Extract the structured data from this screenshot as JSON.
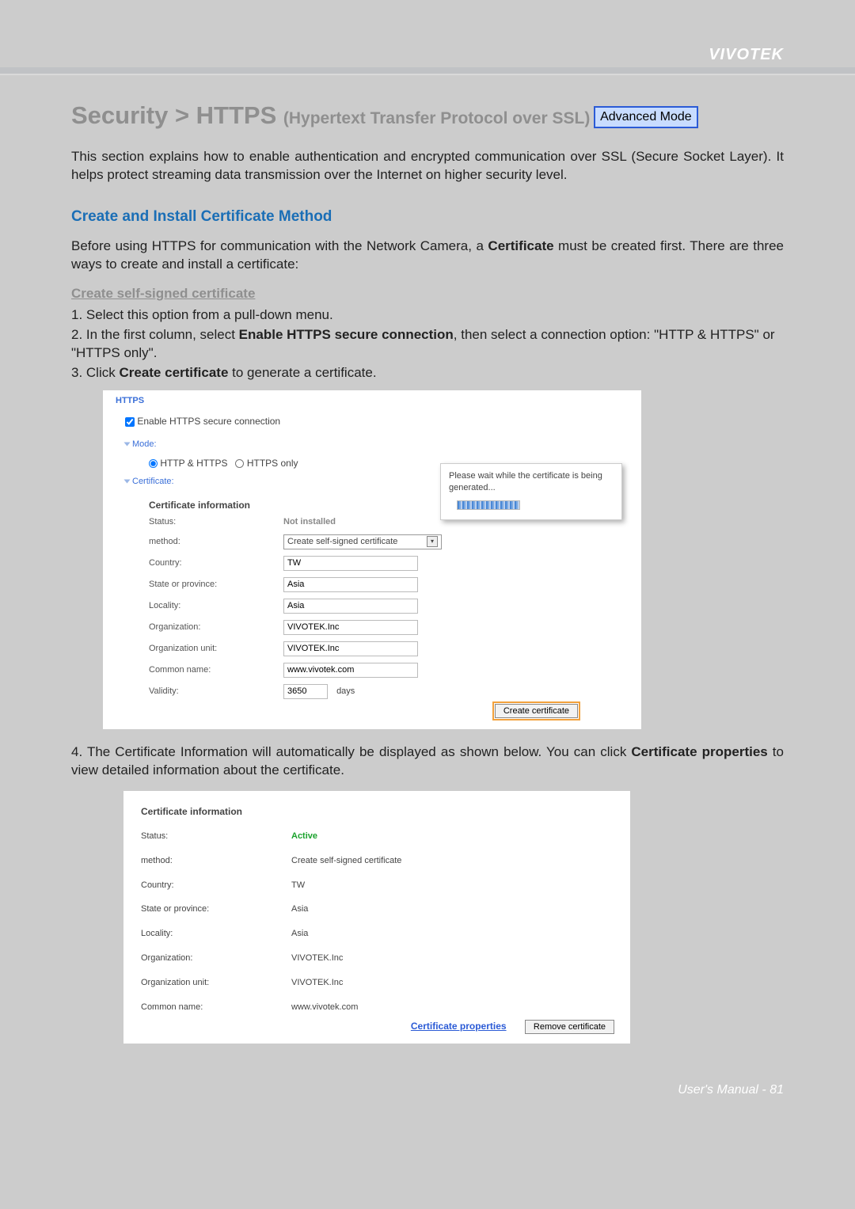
{
  "brand": "VIVOTEK",
  "title": {
    "main": "Security >  HTTPS ",
    "sub": "(Hypertext Transfer Protocol over SSL)",
    "badge": "Advanced Mode"
  },
  "intro": "This section explains how to enable authentication and encrypted communication over SSL (Secure Socket Layer). It helps protect streaming data transmission over the Internet on higher security level.",
  "section_head": "Create and Install Certificate Method",
  "para_before": "Before using HTTPS for communication with the Network Camera, a ",
  "para_before_bold": "Certificate",
  "para_before_rest": " must be created first. There are three ways to create and install a certificate:",
  "sub_head": "Create self-signed certificate",
  "steps": {
    "s1": "1. Select this option from a pull-down menu.",
    "s2a": "2. In the first column, select ",
    "s2b": "Enable HTTPS secure connection",
    "s2c": ", then select a connection option: \"HTTP & HTTPS\" or \"HTTPS only\".",
    "s3a": "3. Click ",
    "s3b": "Create certificate",
    "s3c": " to generate a certificate."
  },
  "shot1": {
    "fieldset": "HTTPS",
    "enable_label": "Enable HTTPS secure connection",
    "mode_label": "Mode:",
    "radio1": "HTTP & HTTPS",
    "radio2": "HTTPS only",
    "cert_label": "Certificate:",
    "cert_info_head": "Certificate information",
    "rows": {
      "status_l": "Status:",
      "status_v": "Not installed",
      "method_l": "method:",
      "method_v": "Create self-signed certificate",
      "country_l": "Country:",
      "country_v": "TW",
      "state_l": "State or province:",
      "state_v": "Asia",
      "locality_l": "Locality:",
      "locality_v": "Asia",
      "org_l": "Organization:",
      "org_v": "VIVOTEK.Inc",
      "orgunit_l": "Organization unit:",
      "orgunit_v": "VIVOTEK.Inc",
      "common_l": "Common name:",
      "common_v": "www.vivotek.com",
      "validity_l": "Validity:",
      "validity_v": "3650",
      "validity_unit": "days"
    },
    "create_btn": "Create certificate",
    "popup_text": "Please wait while the certificate is being generated..."
  },
  "step4a": "4. The Certificate Information will automatically be displayed as shown below. You can click ",
  "step4b": "Certificate properties",
  "step4c": " to view detailed information about the certificate.",
  "shot2": {
    "cert_info_head": "Certificate information",
    "rows": {
      "status_l": "Status:",
      "status_v": "Active",
      "method_l": "method:",
      "method_v": "Create self-signed certificate",
      "country_l": "Country:",
      "country_v": "TW",
      "state_l": "State or province:",
      "state_v": "Asia",
      "locality_l": "Locality:",
      "locality_v": "Asia",
      "org_l": "Organization:",
      "org_v": "VIVOTEK.Inc",
      "orgunit_l": "Organization unit:",
      "orgunit_v": "VIVOTEK.Inc",
      "common_l": "Common name:",
      "common_v": "www.vivotek.com"
    },
    "cert_props_link": "Certificate properties",
    "remove_btn": "Remove certificate"
  },
  "footer": {
    "label": "User's Manual - ",
    "page": "81"
  }
}
